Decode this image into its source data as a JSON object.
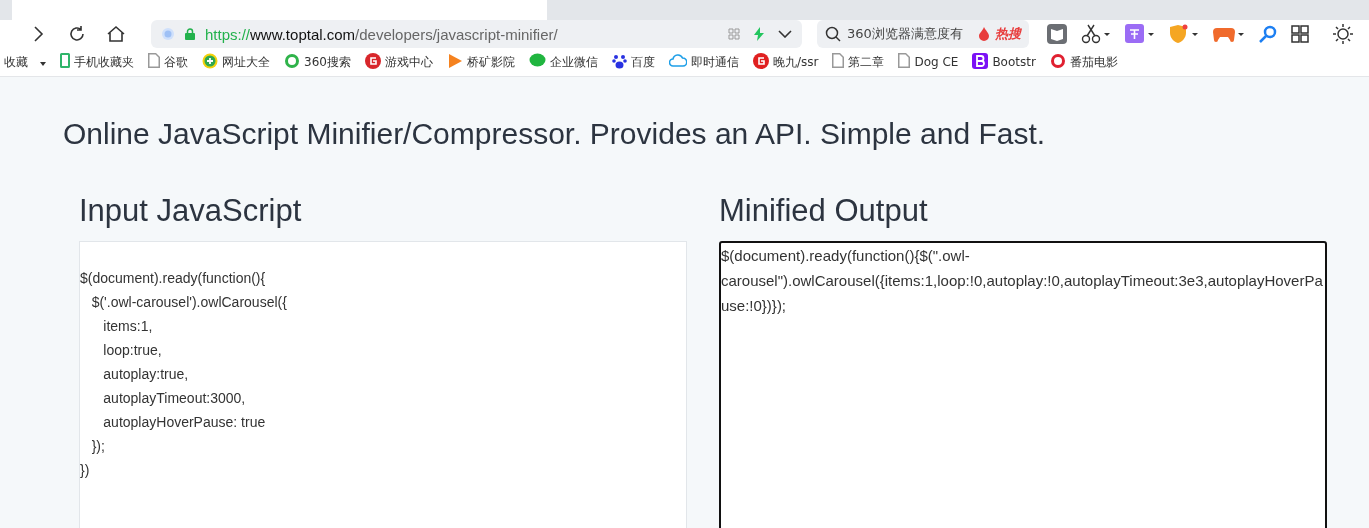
{
  "address_bar": {
    "scheme": "https://",
    "host": "www.toptal.com",
    "path": "/developers/javascript-minifier/"
  },
  "search": {
    "placeholder": "360浏览器满意度有",
    "hot_label": "热搜"
  },
  "bookmarks": [
    {
      "label": "收藏",
      "kind": "menu"
    },
    {
      "label": "手机收藏夹",
      "kind": "phone",
      "color": "#2fb56a"
    },
    {
      "label": "谷歌",
      "kind": "page",
      "color": "#999999"
    },
    {
      "label": "网址大全",
      "kind": "plus",
      "color": "#2fa84f"
    },
    {
      "label": "360搜索",
      "kind": "ring",
      "color": "#2fb34a"
    },
    {
      "label": "游戏中心",
      "kind": "game",
      "color": "#d8262b"
    },
    {
      "label": "桥矿影院",
      "kind": "play",
      "color": "#f5821f"
    },
    {
      "label": "企业微信",
      "kind": "chat",
      "color": "#20b53f"
    },
    {
      "label": "百度",
      "kind": "paw",
      "color": "#2932e1"
    },
    {
      "label": "即时通信",
      "kind": "cloud",
      "color": "#1e9fe8"
    },
    {
      "label": "晚九/ssr",
      "kind": "game",
      "color": "#e02020"
    },
    {
      "label": "第二章",
      "kind": "page",
      "color": "#999999"
    },
    {
      "label": "Dog CE",
      "kind": "page",
      "color": "#999999"
    },
    {
      "label": "Bootstr",
      "kind": "b",
      "color": "#7b11f5"
    },
    {
      "label": "番茄电影",
      "kind": "ring",
      "color": "#e02030"
    }
  ],
  "subtitle": "Online JavaScript Minifier/Compressor. Provides an API. Simple and Fast.",
  "input_panel": {
    "title": "Input JavaScript",
    "code_lines": [
      "$(document).ready(function(){",
      "   $('.owl-carousel').owlCarousel({",
      "      items:1,",
      "      loop:true,",
      "      autoplay:true,",
      "      autoplayTimeout:3000,",
      "      autoplayHoverPause: true",
      "   });",
      "})"
    ]
  },
  "output_panel": {
    "title": "Minified Output",
    "value": "$(document).ready(function(){$(\".owl-carousel\").owlCarousel({items:1,loop:!0,autoplay:!0,autoplayTimeout:3e3,autoplayHoverPause:!0})});"
  }
}
